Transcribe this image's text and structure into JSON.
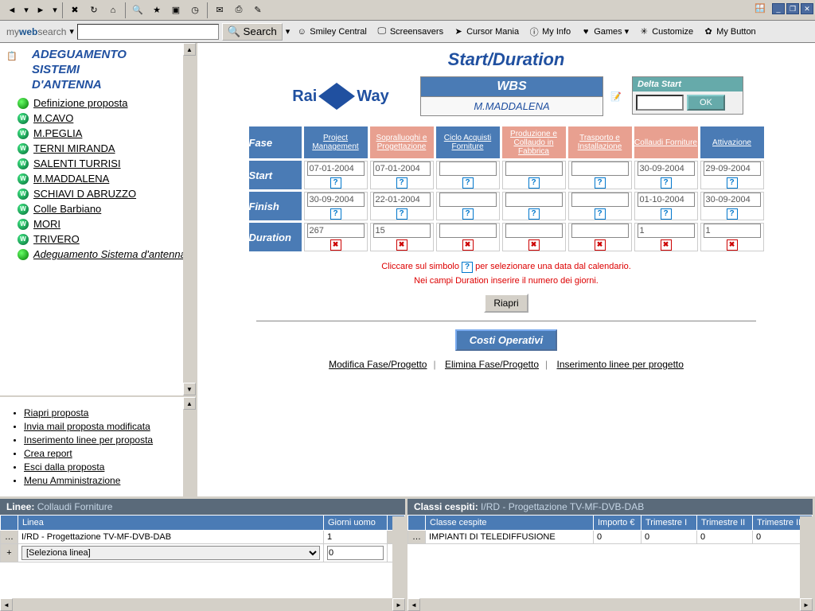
{
  "browser": {
    "search_brand_pre": "my",
    "search_brand_bold": "web",
    "search_brand_post": "search",
    "search_btn": "Search",
    "items": [
      "Smiley Central",
      "Screensavers",
      "Cursor Mania",
      "My Info",
      "Games",
      "Customize",
      "My Button"
    ]
  },
  "sidebar": {
    "title_l1": "ADEGUAMENTO",
    "title_l2": "SISTEMI",
    "title_l3": "D'ANTENNA",
    "items": [
      {
        "label": "Definizione proposta",
        "type": "green"
      },
      {
        "label": "M.CAVO",
        "type": "w"
      },
      {
        "label": "M.PEGLIA",
        "type": "w"
      },
      {
        "label": "TERNI MIRANDA",
        "type": "w"
      },
      {
        "label": "SALENTI TURRISI",
        "type": "w"
      },
      {
        "label": "M.MADDALENA",
        "type": "w"
      },
      {
        "label": "SCHIAVI D ABRUZZO",
        "type": "w"
      },
      {
        "label": "Colle Barbiano",
        "type": "w"
      },
      {
        "label": "MORI",
        "type": "w"
      },
      {
        "label": "TRIVERO",
        "type": "w"
      },
      {
        "label": "Adeguamento Sistema d'antenna",
        "type": "green",
        "italic": true
      }
    ],
    "actions": [
      "Riapri proposta",
      "Invia mail proposta modificata",
      "Inserimento linee per proposta",
      "Crea report",
      "Esci dalla proposta",
      "Menu Amministrazione"
    ]
  },
  "content": {
    "page_title": "Start/Duration",
    "logo1": "Rai",
    "logo2": "Way",
    "wbs_header": "WBS",
    "wbs_value": "M.MADDALENA",
    "delta_header": "Delta Start",
    "ok": "OK",
    "phases": {
      "row_fase": "Fase",
      "row_start": "Start",
      "row_finish": "Finish",
      "row_duration": "Duration",
      "cols": [
        {
          "label": "Project Management",
          "cls": "blue"
        },
        {
          "label": "Sopralluoghi e Progettazione",
          "cls": "pink"
        },
        {
          "label": "Ciclo Acquisti Forniture",
          "cls": "blue"
        },
        {
          "label": "Produzione e Collaudo in Fabbrica",
          "cls": "pink"
        },
        {
          "label": "Trasporto e Installazione",
          "cls": "pink"
        },
        {
          "label": "Collaudi Forniture",
          "cls": "pink"
        },
        {
          "label": "Attivazione",
          "cls": "blue"
        }
      ],
      "start": [
        "07-01-2004",
        "07-01-2004",
        "",
        "",
        "",
        "30-09-2004",
        "29-09-2004"
      ],
      "finish": [
        "30-09-2004",
        "22-01-2004",
        "",
        "",
        "",
        "01-10-2004",
        "30-09-2004"
      ],
      "duration": [
        "267",
        "15",
        "",
        "",
        "",
        "1",
        "1"
      ]
    },
    "help1_a": "Cliccare sul simbolo ",
    "help1_b": " per selezionare una data dal calendario.",
    "help2": "Nei campi Duration inserire il numero dei giorni.",
    "riapri": "Riapri",
    "costi": "Costi Operativi",
    "links": [
      "Modifica Fase/Progetto",
      "Elimina Fase/Progetto",
      "Inserimento linee per progetto"
    ]
  },
  "panel_linee": {
    "title": "Linee:",
    "subtitle": "Collaudi Forniture",
    "col1": "Linea",
    "col2": "Giorni uomo",
    "row1_linea": "I/RD - Progettazione TV-MF-DVB-DAB",
    "row1_gu": "1",
    "sel_placeholder": "[Seleziona linea]",
    "sel_gu": "0"
  },
  "panel_classi": {
    "title": "Classi cespiti:",
    "subtitle": "I/RD - Progettazione TV-MF-DVB-DAB",
    "cols": [
      "Classe cespite",
      "Importo €",
      "Trimestre I",
      "Trimestre II",
      "Trimestre III"
    ],
    "row": [
      "IMPIANTI DI TELEDIFFUSIONE",
      "0",
      "0",
      "0",
      "0"
    ]
  }
}
